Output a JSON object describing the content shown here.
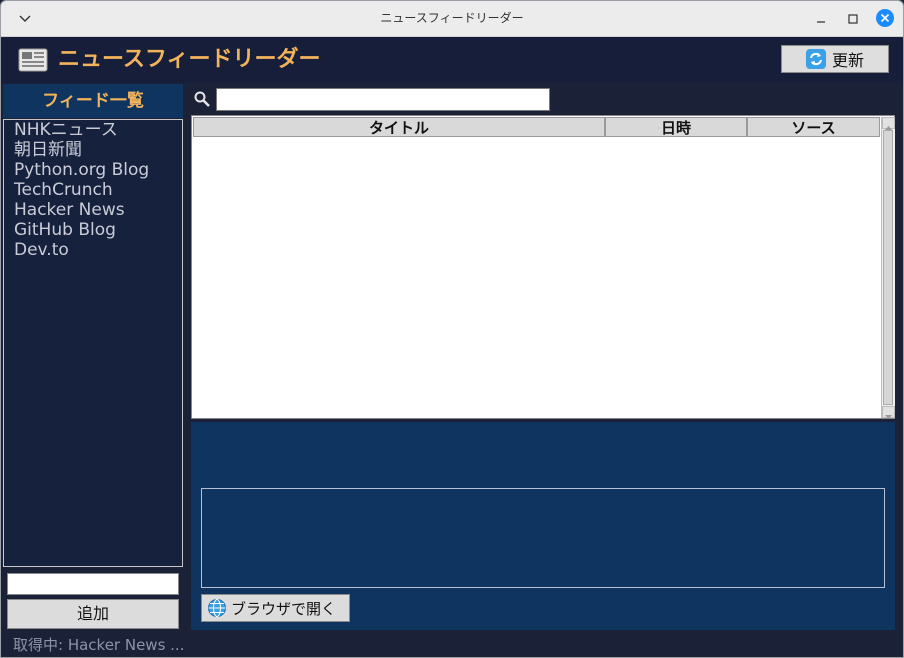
{
  "window": {
    "title": "ニュースフィードリーダー"
  },
  "header": {
    "title": "ニュースフィードリーダー",
    "refresh_label": "更新"
  },
  "sidebar": {
    "heading": "フィード一覧",
    "feeds": [
      "NHKニュース",
      "朝日新聞",
      "Python.org Blog",
      "TechCrunch",
      "Hacker News",
      "GitHub Blog",
      "Dev.to"
    ],
    "new_feed_value": "",
    "add_label": "追加"
  },
  "search": {
    "value": ""
  },
  "table": {
    "columns": [
      "タイトル",
      "日時",
      "ソース"
    ],
    "rows": []
  },
  "detail": {
    "text": "",
    "open_label": "ブラウザで開く"
  },
  "status": {
    "text": "取得中: Hacker News ..."
  },
  "colors": {
    "accent": "#f2b35b",
    "background": "#1b2238",
    "panel": "#0f3460",
    "close_button": "#1a8cff"
  }
}
